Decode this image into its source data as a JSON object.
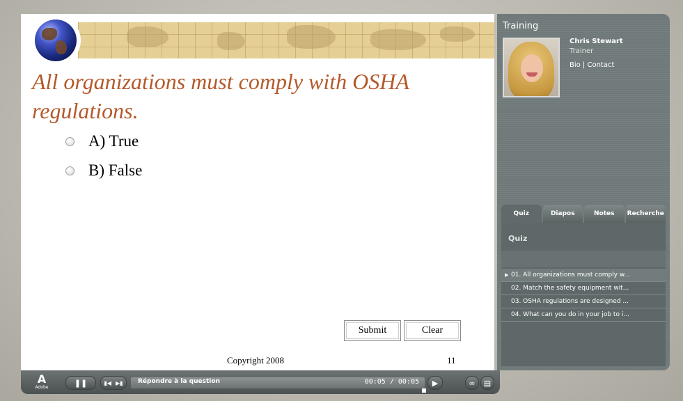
{
  "slide": {
    "question": "All organizations must comply with OSHA regulations.",
    "options": [
      "A) True",
      "B) False"
    ],
    "submit_label": "Submit",
    "clear_label": "Clear",
    "copyright": "Copyright 2008",
    "slide_number": "11"
  },
  "playbar": {
    "adobe_mark": "A",
    "adobe_word": "Adobe",
    "pause_icon": "pause-icon",
    "prev_icon": "skip-back-icon",
    "next_icon": "skip-forward-icon",
    "track_label": "Répondre à la question",
    "time": "00:05 / 00:05",
    "progress": 1.0,
    "volume_icon": "speaker-icon",
    "attachment_icon": "paperclip-icon",
    "captions_icon": "captions-icon"
  },
  "side": {
    "title": "Training",
    "trainer_name": "Chris Stewart",
    "trainer_role": "Trainer",
    "trainer_links": "Bio | Contact",
    "tabs": [
      "Quiz",
      "Diapos",
      "Notes",
      "Recherche"
    ],
    "active_tab": 0,
    "panel_title": "Quiz",
    "questions": [
      "01. All organizations must comply w...",
      "02. Match the safety equipment wit...",
      "03. OSHA regulations are designed ...",
      "04. What can you do in your job to i..."
    ],
    "active_question": 0
  },
  "colors": {
    "question_text": "#b4592a",
    "panel_bg": "#707979",
    "playbar_bg": "#5a6060"
  }
}
